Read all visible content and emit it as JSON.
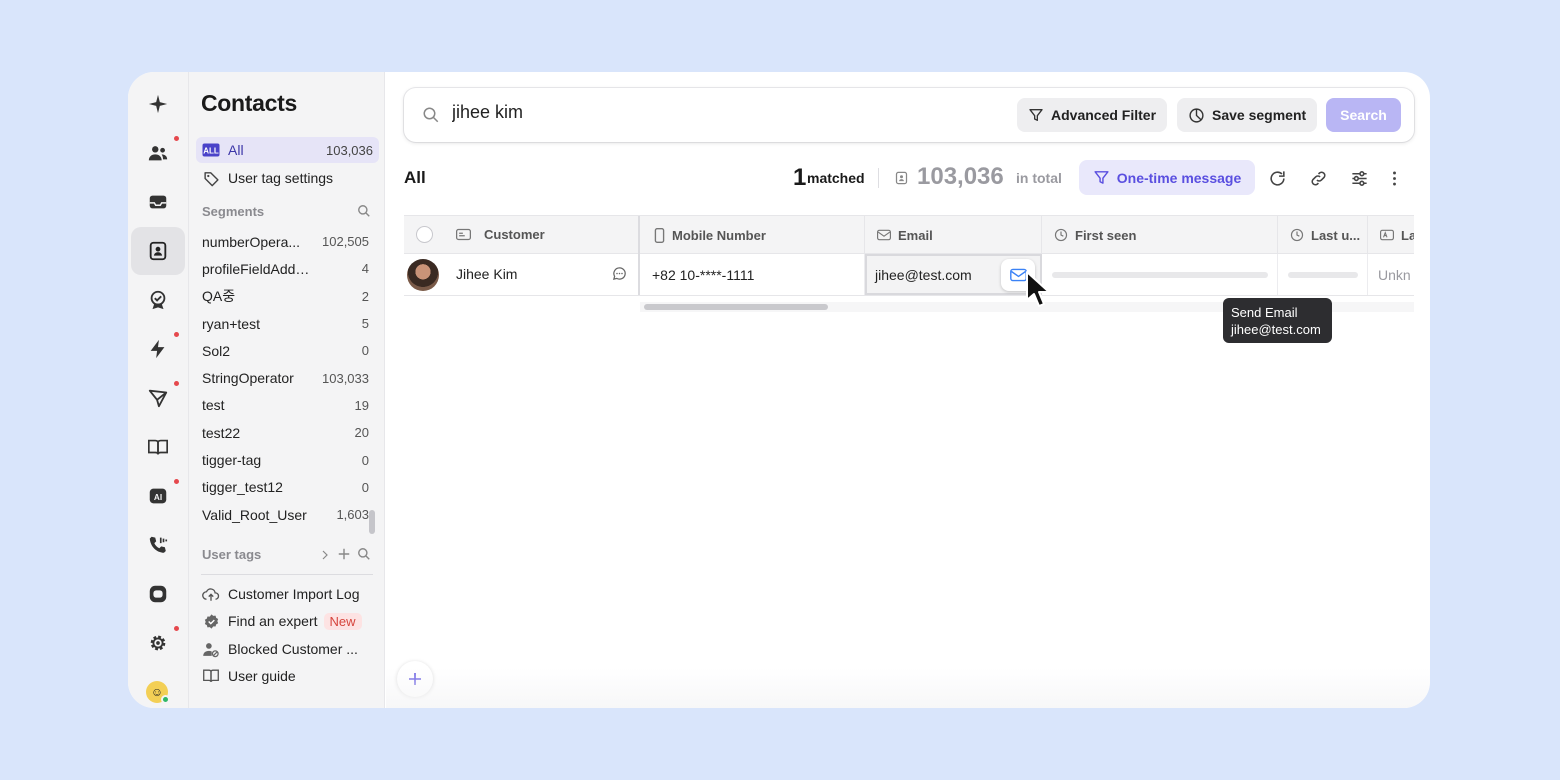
{
  "sidebar": {
    "title": "Contacts",
    "all": {
      "label": "All",
      "count": "103,036"
    },
    "tag_settings": "User tag settings",
    "segments_label": "Segments",
    "segments": [
      {
        "name": "numberOpera...",
        "count": "102,505"
      },
      {
        "name": "profileFieldAddTest",
        "count": "4"
      },
      {
        "name": "QA중",
        "count": "2"
      },
      {
        "name": "ryan+test",
        "count": "5"
      },
      {
        "name": "Sol2",
        "count": "0"
      },
      {
        "name": "StringOperator",
        "count": "103,033"
      },
      {
        "name": "test",
        "count": "19"
      },
      {
        "name": "test22",
        "count": "20"
      },
      {
        "name": "tigger-tag",
        "count": "0"
      },
      {
        "name": "tigger_test12",
        "count": "0"
      },
      {
        "name": "Valid_Root_User",
        "count": "1,603"
      }
    ],
    "user_tags_label": "User tags",
    "footer": {
      "import_log": "Customer Import Log",
      "find_expert": "Find an expert",
      "new_badge": "New",
      "blocked": "Blocked Customer ...",
      "guide": "User guide"
    }
  },
  "search": {
    "value": "jihee kim",
    "advanced_filter": "Advanced Filter",
    "save_segment": "Save segment",
    "search_btn": "Search"
  },
  "toolbar": {
    "view": "All",
    "matched_count": "1",
    "matched_label": "matched",
    "total_count": "103,036",
    "total_label": "in total",
    "one_time_message": "One-time message"
  },
  "table": {
    "columns": {
      "customer": "Customer",
      "mobile": "Mobile Number",
      "email": "Email",
      "first_seen": "First seen",
      "last_u": "Last u...",
      "la": "La"
    },
    "row": {
      "name": "Jihee Kim",
      "mobile": "+82 10-****-1111",
      "email": "jihee@test.com",
      "last": "Unkn"
    }
  },
  "tooltip": {
    "title": "Send Email",
    "email": "jihee@test.com"
  },
  "colors": {
    "background": "#d9e5fb",
    "accent": "#5a4fe0",
    "search_button": "#b9b6f4",
    "notification_dot": "#e5484d"
  }
}
